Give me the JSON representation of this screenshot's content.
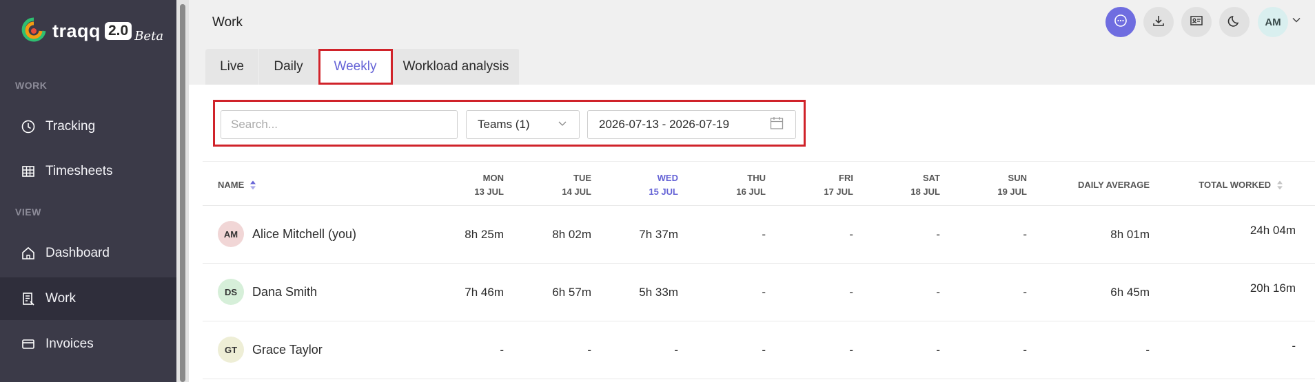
{
  "sidebar": {
    "logo_text": "traqq",
    "logo_version": "2.0",
    "logo_beta": "Beta",
    "section_work": "WORK",
    "section_view": "VIEW",
    "items": [
      {
        "label": "Tracking",
        "icon": "clock-icon"
      },
      {
        "label": "Timesheets",
        "icon": "grid-icon"
      },
      {
        "label": "Dashboard",
        "icon": "home-icon"
      },
      {
        "label": "Work",
        "icon": "document-icon",
        "active": true
      },
      {
        "label": "Invoices",
        "icon": "card-icon"
      }
    ]
  },
  "header": {
    "title": "Work",
    "user_initials": "AM",
    "buttons": [
      "chat-icon",
      "download-icon",
      "id-card-icon",
      "moon-icon"
    ]
  },
  "tabs": [
    {
      "label": "Live"
    },
    {
      "label": "Daily"
    },
    {
      "label": "Weekly",
      "active": true
    },
    {
      "label": "Workload analysis"
    }
  ],
  "filters": {
    "search_placeholder": "Search...",
    "teams_value": "Teams (1)",
    "date_range": "2026-07-13 - 2026-07-19"
  },
  "table": {
    "name_header": "NAME",
    "days": [
      {
        "day": "MON",
        "date": "13 JUL"
      },
      {
        "day": "TUE",
        "date": "14 JUL"
      },
      {
        "day": "WED",
        "date": "15 JUL",
        "today": true
      },
      {
        "day": "THU",
        "date": "16 JUL"
      },
      {
        "day": "FRI",
        "date": "17 JUL"
      },
      {
        "day": "SAT",
        "date": "18 JUL"
      },
      {
        "day": "SUN",
        "date": "19 JUL"
      }
    ],
    "avg_header": "DAILY AVERAGE",
    "total_header": "TOTAL WORKED",
    "rows": [
      {
        "initials": "AM",
        "name": "Alice Mitchell (you)",
        "avatar_color": "#f1d6d6",
        "values": [
          "8h 25m",
          "8h 02m",
          "7h 37m",
          "-",
          "-",
          "-",
          "-"
        ],
        "avg": "8h 01m",
        "total": "24h 04m"
      },
      {
        "initials": "DS",
        "name": "Dana Smith",
        "avatar_color": "#d6efd9",
        "values": [
          "7h 46m",
          "6h 57m",
          "5h 33m",
          "-",
          "-",
          "-",
          "-"
        ],
        "avg": "6h 45m",
        "total": "20h 16m"
      },
      {
        "initials": "GT",
        "name": "Grace Taylor",
        "avatar_color": "#eeeed6",
        "values": [
          "-",
          "-",
          "-",
          "-",
          "-",
          "-",
          "-"
        ],
        "avg": "-",
        "total": "-"
      }
    ]
  },
  "colors": {
    "accent": "#6563d6",
    "sidebar_bg": "#3b3a48",
    "highlight_red": "#d0232a"
  }
}
